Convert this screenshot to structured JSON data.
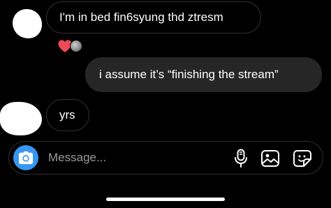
{
  "thread": {
    "messages": [
      {
        "sender": "other",
        "text": "I'm in bed fin6syung thd ztresm"
      },
      {
        "sender": "me",
        "text": "i assume it’s “finishing the stream”"
      },
      {
        "sender": "other",
        "text": "yrs"
      }
    ],
    "reactions": [
      {
        "icon": "heart-icon",
        "color": "#ed4956"
      },
      {
        "icon": "reactor-avatar"
      }
    ]
  },
  "composer": {
    "placeholder": "Message...",
    "camera_icon": "camera-icon",
    "tools": [
      "microphone-icon",
      "gallery-icon",
      "sticker-icon"
    ],
    "accent": "#3797f0"
  }
}
